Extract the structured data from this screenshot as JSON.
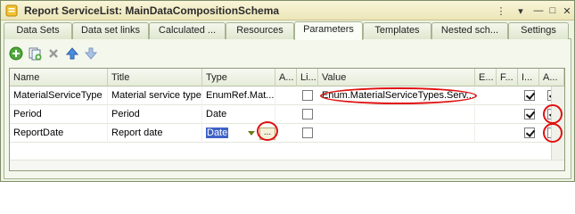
{
  "window": {
    "title": "Report ServiceList: MainDataCompositionSchema",
    "controls": [
      "more-icon",
      "menu-icon",
      "minimize-icon",
      "maximize-icon",
      "close-icon"
    ]
  },
  "tabs": [
    {
      "label": "Data Sets",
      "active": false
    },
    {
      "label": "Data set links",
      "active": false
    },
    {
      "label": "Calculated ...",
      "active": false
    },
    {
      "label": "Resources",
      "active": false
    },
    {
      "label": "Parameters",
      "active": true
    },
    {
      "label": "Templates",
      "active": false
    },
    {
      "label": "Nested sch...",
      "active": false
    },
    {
      "label": "Settings",
      "active": false
    }
  ],
  "toolbar": [
    "add-icon",
    "copy-icon",
    "delete-icon",
    "move-up-icon",
    "move-down-icon"
  ],
  "table": {
    "columns": [
      "Name",
      "Title",
      "Type",
      "A...",
      "Li...",
      "Value",
      "E...",
      "F...",
      "I...",
      "A..."
    ],
    "rows": [
      {
        "name": "MaterialServiceType",
        "title": "Material service type",
        "type": "EnumRef.Mat...",
        "li": false,
        "value": "Enum.MaterialServiceTypes.Serv...",
        "i": true,
        "a": true
      },
      {
        "name": "Period",
        "title": "Period",
        "type": "Date",
        "li": false,
        "value": "",
        "i": true,
        "a": true
      },
      {
        "name": "ReportDate",
        "title": "Report date",
        "type": "Date",
        "li": false,
        "value": "",
        "i": true,
        "a": false
      }
    ],
    "ellipsis": "..."
  },
  "colors": {
    "highlight": "#e01010",
    "selection": "#3d62c8"
  }
}
